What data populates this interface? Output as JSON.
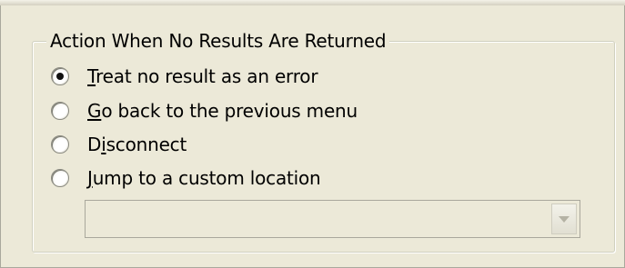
{
  "group": {
    "title": "Action When No Results Are Returned"
  },
  "options": [
    {
      "id": "treat-error",
      "mnemonic": "T",
      "rest": "reat no result as an error",
      "selected": true
    },
    {
      "id": "go-back",
      "mnemonic": "G",
      "rest": "o back to the previous menu",
      "selected": false
    },
    {
      "id": "disconnect",
      "prefix": "D",
      "mnemonic": "i",
      "rest": "sconnect",
      "selected": false
    },
    {
      "id": "jump-custom",
      "mnemonic": "J",
      "rest": "ump to a custom location",
      "selected": false
    }
  ],
  "custom_location": {
    "value": "",
    "enabled": false
  },
  "colors": {
    "dialog_background": "#ece9d8",
    "disabled_text": "#8a8a80"
  },
  "icons": {
    "dropdown": "chevron-down-icon"
  }
}
